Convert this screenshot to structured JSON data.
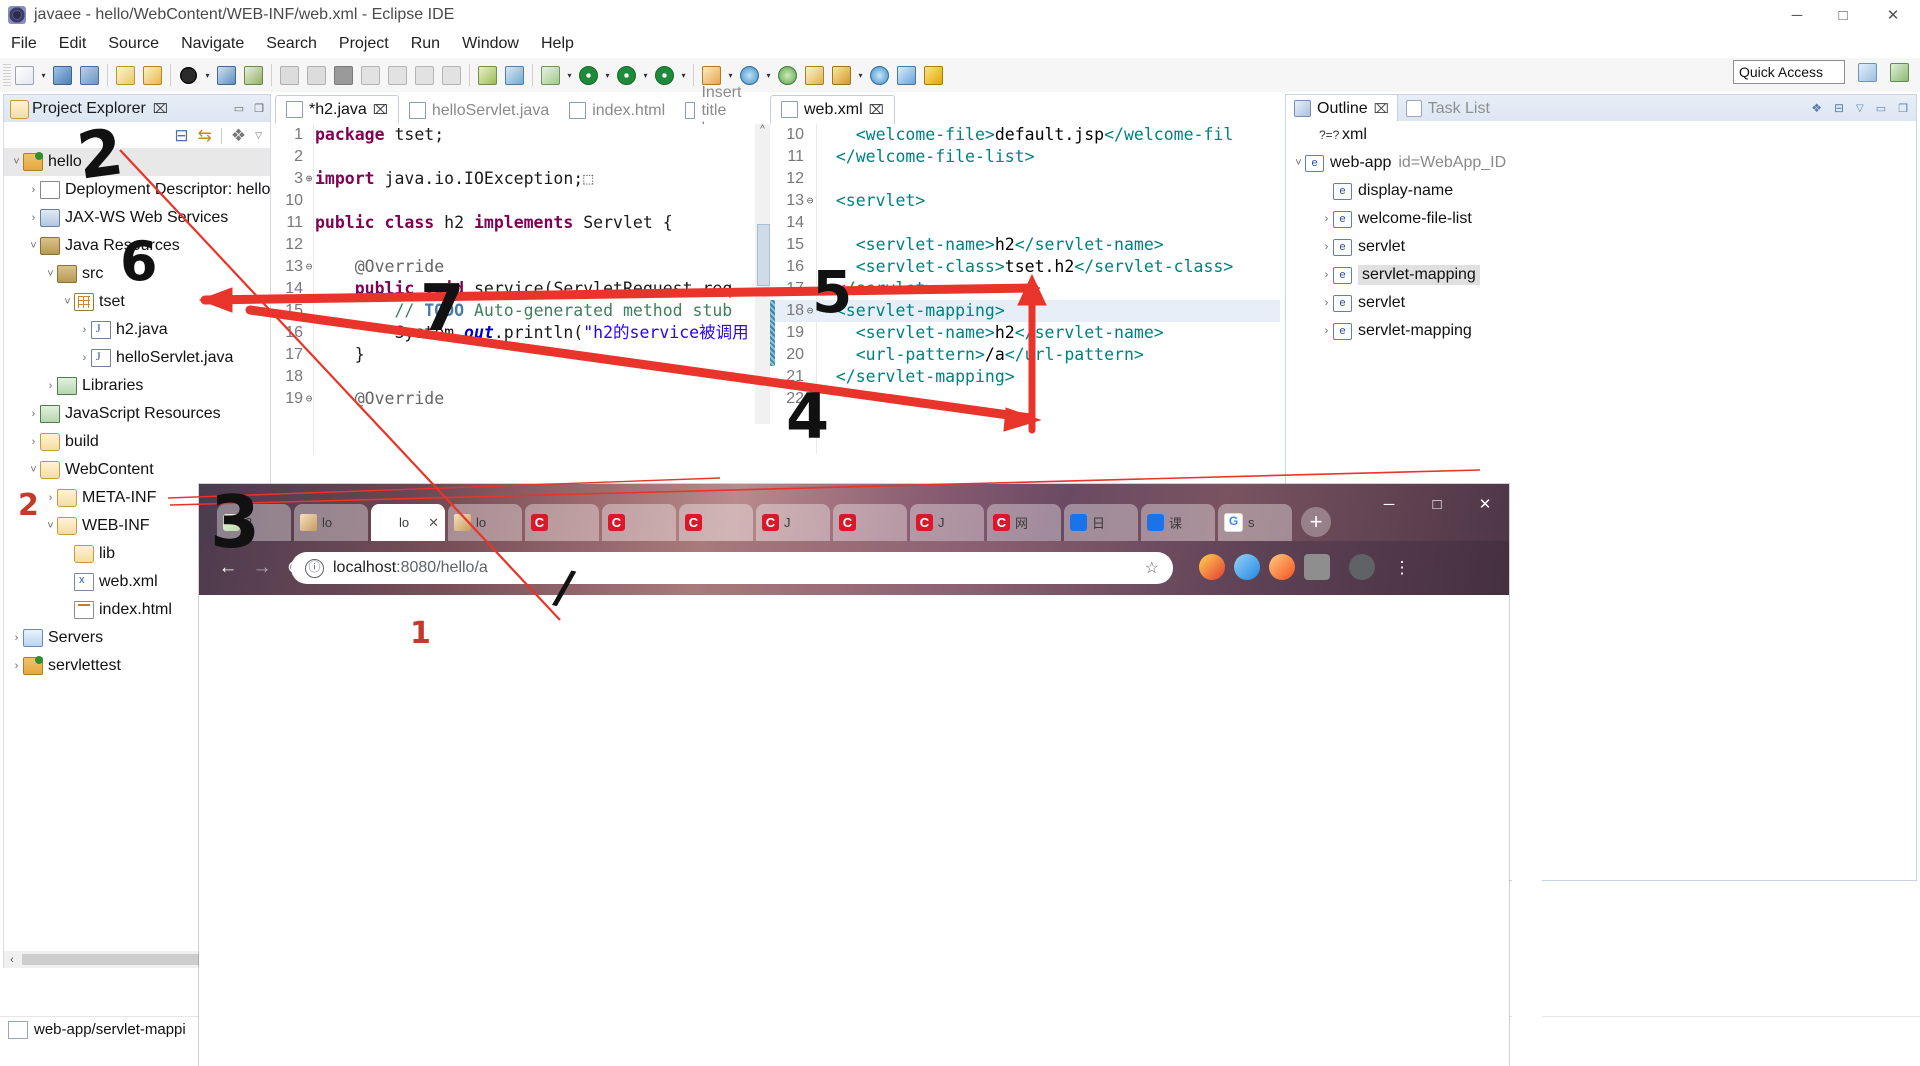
{
  "window": {
    "title": "javaee - hello/WebContent/WEB-INF/web.xml - Eclipse IDE",
    "minimize": "─",
    "maximize": "□",
    "close": "✕"
  },
  "menubar": [
    "File",
    "Edit",
    "Source",
    "Navigate",
    "Search",
    "Project",
    "Run",
    "Window",
    "Help"
  ],
  "toolbar": {
    "quick_access": "Quick Access"
  },
  "project_explorer": {
    "title": "Project Explorer",
    "close_glyph": "⌧",
    "items": [
      {
        "label": "hello",
        "indent": 0,
        "twisty": "˅",
        "icon": "ic-proj",
        "selected": true
      },
      {
        "label": "Deployment Descriptor: hello",
        "indent": 1,
        "twisty": "›",
        "icon": "ic-dd",
        "selected": false
      },
      {
        "label": "JAX-WS Web Services",
        "indent": 1,
        "twisty": "›",
        "icon": "ic-ws",
        "selected": false
      },
      {
        "label": "Java Resources",
        "indent": 1,
        "twisty": "˅",
        "icon": "ic-jar",
        "selected": false
      },
      {
        "label": "src",
        "indent": 2,
        "twisty": "˅",
        "icon": "ic-jar",
        "selected": false
      },
      {
        "label": "tset",
        "indent": 3,
        "twisty": "˅",
        "icon": "ic-pkg",
        "selected": false
      },
      {
        "label": "h2.java",
        "indent": 4,
        "twisty": "›",
        "icon": "ic-java",
        "selected": false
      },
      {
        "label": "helloServlet.java",
        "indent": 4,
        "twisty": "›",
        "icon": "ic-java",
        "selected": false
      },
      {
        "label": "Libraries",
        "indent": 2,
        "twisty": "›",
        "icon": "ic-lib",
        "selected": false
      },
      {
        "label": "JavaScript Resources",
        "indent": 1,
        "twisty": "›",
        "icon": "ic-lib",
        "selected": false
      },
      {
        "label": "build",
        "indent": 1,
        "twisty": "›",
        "icon": "ic-folder",
        "selected": false
      },
      {
        "label": "WebContent",
        "indent": 1,
        "twisty": "˅",
        "icon": "ic-folder",
        "selected": false
      },
      {
        "label": "META-INF",
        "indent": 2,
        "twisty": "›",
        "icon": "ic-folder",
        "selected": false
      },
      {
        "label": "WEB-INF",
        "indent": 2,
        "twisty": "˅",
        "icon": "ic-folder",
        "selected": false
      },
      {
        "label": "lib",
        "indent": 3,
        "twisty": "",
        "icon": "ic-folder",
        "selected": false
      },
      {
        "label": "web.xml",
        "indent": 3,
        "twisty": "",
        "icon": "ic-xml",
        "selected": false
      },
      {
        "label": "index.html",
        "indent": 3,
        "twisty": "",
        "icon": "ic-html",
        "selected": false
      },
      {
        "label": "Servers",
        "indent": 0,
        "twisty": "›",
        "icon": "ic-srv",
        "selected": false
      },
      {
        "label": "servlettest",
        "indent": 0,
        "twisty": "›",
        "icon": "ic-proj",
        "selected": false
      }
    ]
  },
  "editor_left": {
    "tabs": [
      {
        "label": "*h2.java",
        "icon": "java-icon",
        "active": true,
        "close": "⌧"
      },
      {
        "label": "helloServlet.java",
        "icon": "java-icon",
        "active": false,
        "close": ""
      },
      {
        "label": "index.html",
        "icon": "html-icon",
        "active": false,
        "close": ""
      },
      {
        "label": "Insert title here",
        "icon": "web-icon",
        "active": false,
        "close": ""
      }
    ],
    "lines": [
      {
        "no": "1",
        "fold": "",
        "segments": [
          {
            "t": "package ",
            "c": "kw"
          },
          {
            "t": "tset;",
            "c": ""
          }
        ]
      },
      {
        "no": "2",
        "fold": "",
        "segments": []
      },
      {
        "no": "3",
        "fold": "⊕",
        "segments": [
          {
            "t": "import ",
            "c": "kw"
          },
          {
            "t": "java.io.IOException;",
            "c": ""
          },
          {
            "t": "⬚",
            "c": "ann"
          }
        ]
      },
      {
        "no": "10",
        "fold": "",
        "segments": []
      },
      {
        "no": "11",
        "fold": "",
        "segments": [
          {
            "t": "public class ",
            "c": "kw"
          },
          {
            "t": "h2 ",
            "c": ""
          },
          {
            "t": "implements ",
            "c": "kw"
          },
          {
            "t": "Servlet {",
            "c": ""
          }
        ]
      },
      {
        "no": "12",
        "fold": "",
        "segments": []
      },
      {
        "no": "13",
        "fold": "⊖",
        "segments": [
          {
            "t": "    @Override",
            "c": "ann"
          }
        ]
      },
      {
        "no": "14",
        "fold": "",
        "segments": [
          {
            "t": "    ",
            "c": ""
          },
          {
            "t": "public void ",
            "c": "kw"
          },
          {
            "t": "service(ServletRequest req",
            "c": ""
          }
        ]
      },
      {
        "no": "15",
        "fold": "",
        "segments": [
          {
            "t": "        // ",
            "c": "cmt"
          },
          {
            "t": "TODO",
            "c": "todo"
          },
          {
            "t": " Auto-generated method stub",
            "c": "cmt"
          }
        ]
      },
      {
        "no": "16",
        "fold": "",
        "segments": [
          {
            "t": "        System.",
            "c": ""
          },
          {
            "t": "out",
            "c": "fld"
          },
          {
            "t": ".println(",
            "c": ""
          },
          {
            "t": "\"h2的service被调用",
            "c": "str"
          }
        ]
      },
      {
        "no": "17",
        "fold": "",
        "segments": [
          {
            "t": "    }",
            "c": ""
          }
        ]
      },
      {
        "no": "18",
        "fold": "",
        "segments": []
      },
      {
        "no": "19",
        "fold": "⊖",
        "segments": [
          {
            "t": "    @Override",
            "c": "ann"
          }
        ]
      }
    ]
  },
  "editor_right": {
    "tabs": [
      {
        "label": "web.xml",
        "icon": "xml-icon",
        "active": true,
        "close": "⌧"
      }
    ],
    "lines": [
      {
        "no": "10",
        "fold": "",
        "highlight": false,
        "changed": false,
        "segments": [
          {
            "t": "    ",
            "c": ""
          },
          {
            "t": "<welcome-file>",
            "c": "xml-tag"
          },
          {
            "t": "default.jsp",
            "c": "xml-txt"
          },
          {
            "t": "</welcome-fil",
            "c": "xml-tag"
          }
        ]
      },
      {
        "no": "11",
        "fold": "",
        "highlight": false,
        "changed": false,
        "segments": [
          {
            "t": "  ",
            "c": ""
          },
          {
            "t": "</welcome-file-list>",
            "c": "xml-tag"
          }
        ]
      },
      {
        "no": "12",
        "fold": "",
        "highlight": false,
        "changed": false,
        "segments": []
      },
      {
        "no": "13",
        "fold": "⊖",
        "highlight": false,
        "changed": false,
        "segments": [
          {
            "t": "  ",
            "c": ""
          },
          {
            "t": "<servlet>",
            "c": "xml-tag"
          }
        ]
      },
      {
        "no": "14",
        "fold": "",
        "highlight": false,
        "changed": false,
        "segments": []
      },
      {
        "no": "15",
        "fold": "",
        "highlight": false,
        "changed": false,
        "segments": [
          {
            "t": "    ",
            "c": ""
          },
          {
            "t": "<servlet-name>",
            "c": "xml-tag"
          },
          {
            "t": "h2",
            "c": "xml-txt"
          },
          {
            "t": "</servlet-name>",
            "c": "xml-tag"
          }
        ]
      },
      {
        "no": "16",
        "fold": "",
        "highlight": false,
        "changed": false,
        "segments": [
          {
            "t": "    ",
            "c": ""
          },
          {
            "t": "<servlet-class>",
            "c": "xml-tag"
          },
          {
            "t": "tset.h2",
            "c": "xml-txt"
          },
          {
            "t": "</servlet-class>",
            "c": "xml-tag"
          }
        ]
      },
      {
        "no": "17",
        "fold": "",
        "highlight": false,
        "changed": false,
        "segments": [
          {
            "t": "  ",
            "c": ""
          },
          {
            "t": "</servlet>",
            "c": "xml-tag"
          }
        ]
      },
      {
        "no": "18",
        "fold": "⊖",
        "highlight": true,
        "changed": true,
        "segments": [
          {
            "t": "  ",
            "c": ""
          },
          {
            "t": "<servlet-mapping>",
            "c": "xml-tag"
          }
        ]
      },
      {
        "no": "19",
        "fold": "",
        "highlight": false,
        "changed": true,
        "segments": [
          {
            "t": "    ",
            "c": ""
          },
          {
            "t": "<servlet-name>",
            "c": "xml-tag"
          },
          {
            "t": "h2",
            "c": "xml-txt"
          },
          {
            "t": "</servlet-name>",
            "c": "xml-tag"
          }
        ]
      },
      {
        "no": "20",
        "fold": "",
        "highlight": false,
        "changed": true,
        "segments": [
          {
            "t": "    ",
            "c": ""
          },
          {
            "t": "<url-pattern>",
            "c": "xml-tag"
          },
          {
            "t": "/a",
            "c": "xml-txt"
          },
          {
            "t": "</url-pattern>",
            "c": "xml-tag"
          }
        ]
      },
      {
        "no": "21",
        "fold": "",
        "highlight": false,
        "changed": false,
        "segments": [
          {
            "t": "  ",
            "c": ""
          },
          {
            "t": "</servlet-mapping>",
            "c": "xml-tag"
          }
        ]
      },
      {
        "no": "22",
        "fold": "",
        "highlight": false,
        "changed": false,
        "segments": []
      }
    ]
  },
  "outline": {
    "tabs": [
      {
        "label": "Outline",
        "active": true,
        "close": "⌧"
      },
      {
        "label": "Task List",
        "active": false,
        "close": ""
      }
    ],
    "items": [
      {
        "label": "xml",
        "suffix": "",
        "indent": 1,
        "twisty": "",
        "kind": "pi",
        "selected": false
      },
      {
        "label": "web-app",
        "suffix": "id=WebApp_ID",
        "indent": 0,
        "twisty": "˅",
        "kind": "element",
        "selected": false
      },
      {
        "label": "display-name",
        "suffix": "",
        "indent": 2,
        "twisty": "",
        "kind": "element",
        "selected": false
      },
      {
        "label": "welcome-file-list",
        "suffix": "",
        "indent": 2,
        "twisty": "›",
        "kind": "element",
        "selected": false
      },
      {
        "label": "servlet",
        "suffix": "",
        "indent": 2,
        "twisty": "›",
        "kind": "element",
        "selected": false
      },
      {
        "label": "servlet-mapping",
        "suffix": "",
        "indent": 2,
        "twisty": "›",
        "kind": "element",
        "selected": true
      },
      {
        "label": "servlet",
        "suffix": "",
        "indent": 2,
        "twisty": "›",
        "kind": "element",
        "selected": false
      },
      {
        "label": "servlet-mapping",
        "suffix": "",
        "indent": 2,
        "twisty": "›",
        "kind": "element",
        "selected": false
      }
    ]
  },
  "statusbar": {
    "text": "web-app/servlet-mappi"
  },
  "browser": {
    "url_display": "localhost:8080/hello/a",
    "url_host": "localhost",
    "url_rest": ":8080/hello/a",
    "back": "←",
    "forward": "→",
    "reload": "⟳",
    "info_glyph": "ⓘ",
    "star_glyph": "☆",
    "newtab_glyph": "+",
    "minimize": "─",
    "maximize": "□",
    "close": "✕",
    "tabs": [
      {
        "label": "2",
        "favicon": "fav-2345",
        "state": "normal"
      },
      {
        "label": "lo",
        "favicon": "fav-cat",
        "state": "normal"
      },
      {
        "label": "lo",
        "favicon": "",
        "state": "active"
      },
      {
        "label": "lo",
        "favicon": "fav-cat",
        "state": "normal"
      },
      {
        "label": "",
        "favicon": "fav-c",
        "state": "normal"
      },
      {
        "label": "",
        "favicon": "fav-c",
        "state": "normal"
      },
      {
        "label": "",
        "favicon": "fav-c",
        "state": "normal"
      },
      {
        "label": "J",
        "favicon": "fav-c",
        "state": "normal"
      },
      {
        "label": "",
        "favicon": "fav-c",
        "state": "normal"
      },
      {
        "label": "J",
        "favicon": "fav-c",
        "state": "normal"
      },
      {
        "label": "网",
        "favicon": "fav-c",
        "state": "normal"
      },
      {
        "label": "日",
        "favicon": "fav-cal",
        "state": "normal"
      },
      {
        "label": "课",
        "favicon": "fav-cal",
        "state": "normal"
      },
      {
        "label": "s",
        "favicon": "fav-g",
        "state": "normal"
      }
    ]
  },
  "annotations": [
    {
      "id": "1",
      "text": "1",
      "color": "#c23b28"
    },
    {
      "id": "2",
      "text": "2",
      "color": "#c23b28"
    },
    {
      "id": "3",
      "text": "3",
      "color": "#111111"
    },
    {
      "id": "4",
      "text": "4",
      "color": "#111111"
    },
    {
      "id": "5",
      "text": "5",
      "color": "#111111"
    },
    {
      "id": "6",
      "text": "6",
      "color": "#111111"
    },
    {
      "id": "7",
      "text": "7",
      "color": "#111111"
    },
    {
      "id": "2b",
      "text": "2",
      "color": "#111111"
    }
  ]
}
